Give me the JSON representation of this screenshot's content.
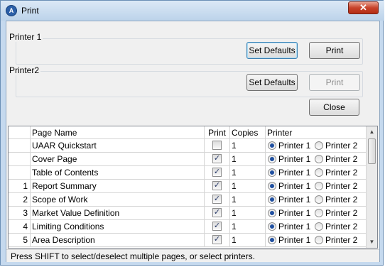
{
  "window": {
    "title": "Print",
    "icon": "app-logo-icon",
    "close_label": "✕"
  },
  "printer1": {
    "label": "Printer 1",
    "set_defaults_label": "Set Defaults",
    "print_label": "Print"
  },
  "printer2": {
    "label": "Printer2",
    "set_defaults_label": "Set Defaults",
    "print_label": "Print"
  },
  "close_label": "Close",
  "table": {
    "headers": {
      "page_name": "Page Name",
      "print": "Print",
      "copies": "Copies",
      "printer": "Printer"
    },
    "rows": [
      {
        "num": "",
        "name": "UAAR Quickstart",
        "print": false,
        "copies": "1",
        "printer": "Printer 1",
        "opt1": "Printer 1",
        "opt2": "Printer 2"
      },
      {
        "num": "",
        "name": "Cover Page",
        "print": true,
        "copies": "1",
        "printer": "Printer 1",
        "opt1": "Printer 1",
        "opt2": "Printer 2"
      },
      {
        "num": "",
        "name": "Table of Contents",
        "print": true,
        "copies": "1",
        "printer": "Printer 1",
        "opt1": "Printer 1",
        "opt2": "Printer 2"
      },
      {
        "num": "1",
        "name": "Report Summary",
        "print": true,
        "copies": "1",
        "printer": "Printer 1",
        "opt1": "Printer 1",
        "opt2": "Printer 2"
      },
      {
        "num": "2",
        "name": "Scope of Work",
        "print": true,
        "copies": "1",
        "printer": "Printer 1",
        "opt1": "Printer 1",
        "opt2": "Printer 2"
      },
      {
        "num": "3",
        "name": "Market Value Definition",
        "print": true,
        "copies": "1",
        "printer": "Printer 1",
        "opt1": "Printer 1",
        "opt2": "Printer 2"
      },
      {
        "num": "4",
        "name": "Limiting Conditions",
        "print": true,
        "copies": "1",
        "printer": "Printer 1",
        "opt1": "Printer 1",
        "opt2": "Printer 2"
      },
      {
        "num": "5",
        "name": "Area Description",
        "print": true,
        "copies": "1",
        "printer": "Printer 1",
        "opt1": "Printer 1",
        "opt2": "Printer 2"
      }
    ]
  },
  "status_text": "Press SHIFT to select/deselect multiple pages, or select printers."
}
